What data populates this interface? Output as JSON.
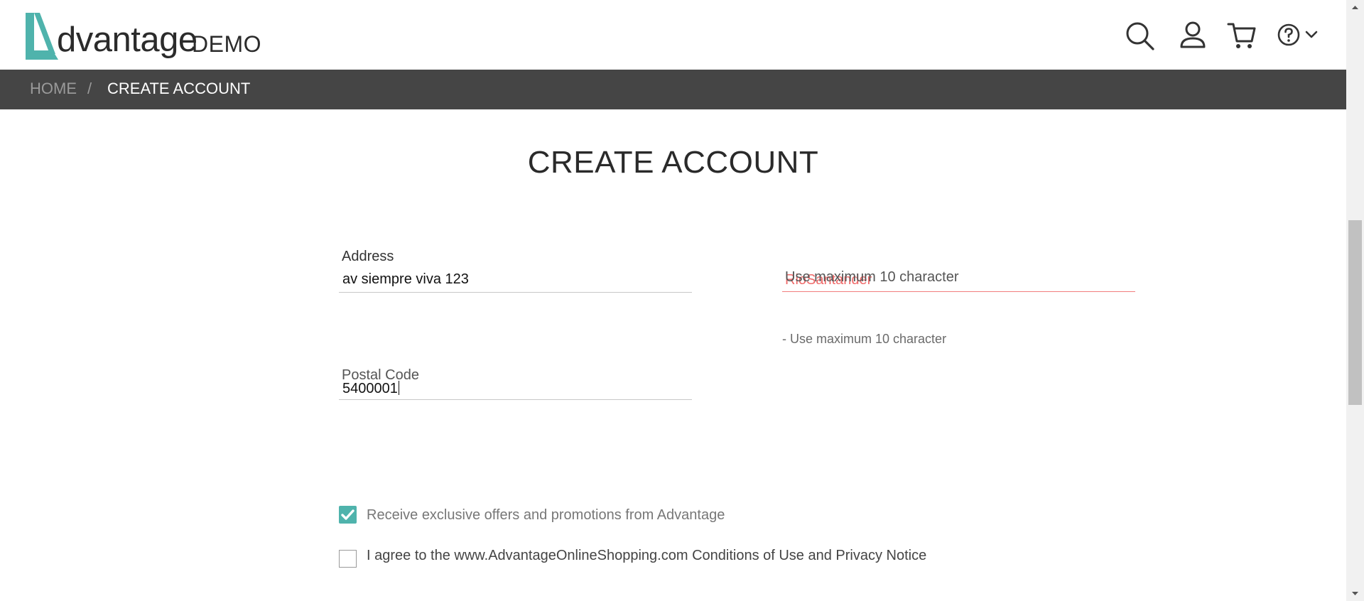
{
  "brand": {
    "word": "dvantage",
    "suffix": "DEMO",
    "accent": "#4fb3ac"
  },
  "header": {
    "icons": [
      "search-icon",
      "user-icon",
      "cart-icon",
      "help-icon",
      "chevron-down-icon"
    ]
  },
  "breadcrumb": {
    "home": "HOME",
    "separator": "/",
    "current": "CREATE ACCOUNT"
  },
  "page": {
    "title": "CREATE ACCOUNT"
  },
  "form": {
    "address": {
      "label": "Address",
      "value": "av siempre viva 123"
    },
    "state": {
      "ghost_value": "RioSantander",
      "error_label": "Use maximum 10 character",
      "error_hint": "- Use maximum 10 character",
      "error_color": "#f06a6a"
    },
    "postal": {
      "label": "Postal Code",
      "value": "5400001"
    }
  },
  "options": {
    "offers": {
      "label": "Receive exclusive offers and promotions from Advantage",
      "checked": true
    },
    "terms": {
      "label": "I agree to the www.AdvantageOnlineShopping.com Conditions of Use and Privacy Notice",
      "checked": false
    }
  }
}
